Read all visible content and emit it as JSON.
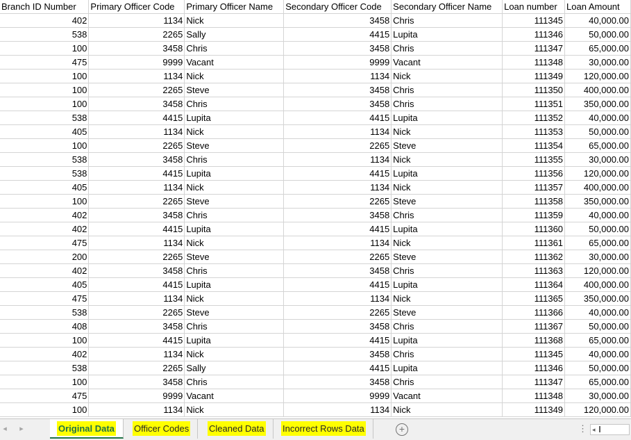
{
  "columns": [
    "Branch ID Number",
    "Primary Officer Code",
    "Primary Officer Name",
    "Secondary Officer Code",
    "Secondary Officer Name",
    "Loan number",
    "Loan Amount"
  ],
  "rows": [
    [
      "402",
      "1134",
      "Nick",
      "3458",
      "Chris",
      "111345",
      "40,000.00"
    ],
    [
      "538",
      "2265",
      "Sally",
      "4415",
      "Lupita",
      "111346",
      "50,000.00"
    ],
    [
      "100",
      "3458",
      "Chris",
      "3458",
      "Chris",
      "111347",
      "65,000.00"
    ],
    [
      "475",
      "9999",
      "Vacant",
      "9999",
      "Vacant",
      "111348",
      "30,000.00"
    ],
    [
      "100",
      "1134",
      "Nick",
      "1134",
      "Nick",
      "111349",
      "120,000.00"
    ],
    [
      "100",
      "2265",
      "Steve",
      "3458",
      "Chris",
      "111350",
      "400,000.00"
    ],
    [
      "100",
      "3458",
      "Chris",
      "3458",
      "Chris",
      "111351",
      "350,000.00"
    ],
    [
      "538",
      "4415",
      "Lupita",
      "4415",
      "Lupita",
      "111352",
      "40,000.00"
    ],
    [
      "405",
      "1134",
      "Nick",
      "1134",
      "Nick",
      "111353",
      "50,000.00"
    ],
    [
      "100",
      "2265",
      "Steve",
      "2265",
      "Steve",
      "111354",
      "65,000.00"
    ],
    [
      "538",
      "3458",
      "Chris",
      "1134",
      "Nick",
      "111355",
      "30,000.00"
    ],
    [
      "538",
      "4415",
      "Lupita",
      "4415",
      "Lupita",
      "111356",
      "120,000.00"
    ],
    [
      "405",
      "1134",
      "Nick",
      "1134",
      "Nick",
      "111357",
      "400,000.00"
    ],
    [
      "100",
      "2265",
      "Steve",
      "2265",
      "Steve",
      "111358",
      "350,000.00"
    ],
    [
      "402",
      "3458",
      "Chris",
      "3458",
      "Chris",
      "111359",
      "40,000.00"
    ],
    [
      "402",
      "4415",
      "Lupita",
      "4415",
      "Lupita",
      "111360",
      "50,000.00"
    ],
    [
      "475",
      "1134",
      "Nick",
      "1134",
      "Nick",
      "111361",
      "65,000.00"
    ],
    [
      "200",
      "2265",
      "Steve",
      "2265",
      "Steve",
      "111362",
      "30,000.00"
    ],
    [
      "402",
      "3458",
      "Chris",
      "3458",
      "Chris",
      "111363",
      "120,000.00"
    ],
    [
      "405",
      "4415",
      "Lupita",
      "4415",
      "Lupita",
      "111364",
      "400,000.00"
    ],
    [
      "475",
      "1134",
      "Nick",
      "1134",
      "Nick",
      "111365",
      "350,000.00"
    ],
    [
      "538",
      "2265",
      "Steve",
      "2265",
      "Steve",
      "111366",
      "40,000.00"
    ],
    [
      "408",
      "3458",
      "Chris",
      "3458",
      "Chris",
      "111367",
      "50,000.00"
    ],
    [
      "100",
      "4415",
      "Lupita",
      "4415",
      "Lupita",
      "111368",
      "65,000.00"
    ],
    [
      "402",
      "1134",
      "Nick",
      "3458",
      "Chris",
      "111345",
      "40,000.00"
    ],
    [
      "538",
      "2265",
      "Sally",
      "4415",
      "Lupita",
      "111346",
      "50,000.00"
    ],
    [
      "100",
      "3458",
      "Chris",
      "3458",
      "Chris",
      "111347",
      "65,000.00"
    ],
    [
      "475",
      "9999",
      "Vacant",
      "9999",
      "Vacant",
      "111348",
      "30,000.00"
    ],
    [
      "100",
      "1134",
      "Nick",
      "1134",
      "Nick",
      "111349",
      "120,000.00"
    ]
  ],
  "tabs": [
    {
      "label": "Original Data",
      "active": true
    },
    {
      "label": "Officer Codes",
      "active": false
    },
    {
      "label": "Cleaned Data",
      "active": false
    },
    {
      "label": "Incorrect Rows Data",
      "active": false
    }
  ],
  "tabbar": {
    "prev_icon": "chevron-left-icon",
    "next_icon": "chevron-right-icon",
    "add_icon": "plus-circle-icon",
    "add_glyph": "+",
    "more_glyph": "⋮",
    "prev_glyph": "◂",
    "next_glyph": "▸"
  },
  "colors": {
    "tab_highlight": "#ffff00",
    "active_tab_text": "#217346",
    "gridline": "#d4d4d4"
  }
}
